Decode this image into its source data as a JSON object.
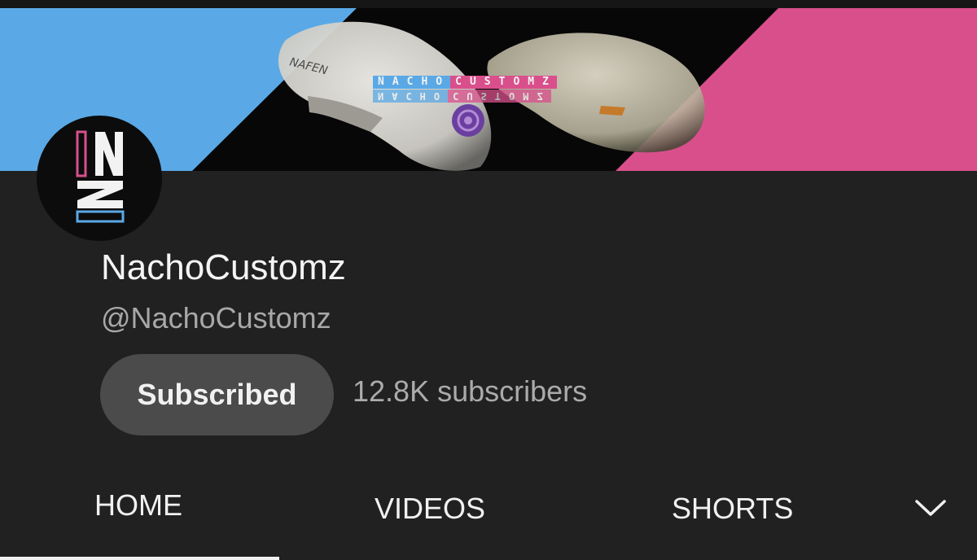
{
  "banner": {
    "logo_text_a": "NACHO",
    "logo_text_b": "CUSTOMZ",
    "mouse_text": "NAFEN",
    "colors": {
      "blue": "#5aa9e6",
      "pink": "#d94f8c",
      "dark": "#070707"
    }
  },
  "channel": {
    "name": "NachoCustomz",
    "handle": "@NachoCustomz",
    "subscribe_label": "Subscribed",
    "subscribers": "12.8K subscribers"
  },
  "tabs": [
    {
      "label": "HOME",
      "active": true
    },
    {
      "label": "VIDEOS",
      "active": false
    },
    {
      "label": "SHORTS",
      "active": false
    }
  ],
  "tabs_more_icon": "chevron-down-icon"
}
